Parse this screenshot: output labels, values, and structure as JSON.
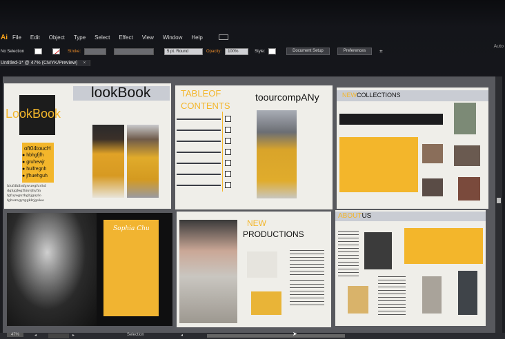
{
  "app": {
    "logo": "Ai",
    "auto_label": "Auto"
  },
  "menu": [
    "File",
    "Edit",
    "Object",
    "Type",
    "Select",
    "Effect",
    "View",
    "Window",
    "Help"
  ],
  "control": {
    "selection": "No Selection",
    "stroke": "Stroke:",
    "brush": "5 pt. Round",
    "opacity": "Opacity:",
    "opacity_value": "100%",
    "style": "Style:",
    "doc_setup": "Document Setup",
    "preferences": "Preferences"
  },
  "tab": {
    "title": "Untitled-1* @ 47% (CMYK/Preview)",
    "close": "×"
  },
  "pages": {
    "p1": {
      "title": "lookBook",
      "logo": "LookBook",
      "list_head": "oft04toucH",
      "bullets": [
        "hbhgfjfh",
        "gruhewjr",
        "huifregnh",
        "jfhuehguh"
      ],
      "body": [
        "hiufdhihsfgwuegfuvhd",
        "dghjgfegfhiuvjhyfm",
        "fgfuyegurhghjguylo",
        "fghuregyrggklrjgoleo"
      ]
    },
    "p2": {
      "toc1": "TABLEOF",
      "toc2": "CONTENTS",
      "company": "toourcompANy"
    },
    "p3": {
      "new": "NEW",
      "collections": "COLLECTIONS"
    },
    "p4": {
      "signature": "Sophia Chu"
    },
    "p5": {
      "new": "NEW",
      "productions": "PRODUCTIONS"
    },
    "p6": {
      "about": "ABOUT",
      "us": "US"
    }
  },
  "status": {
    "zoom": "47%",
    "tool": "Selection"
  },
  "colors": {
    "accent": "#f3b62b",
    "page": "#efeee9",
    "dark": "#1e1e1e"
  }
}
